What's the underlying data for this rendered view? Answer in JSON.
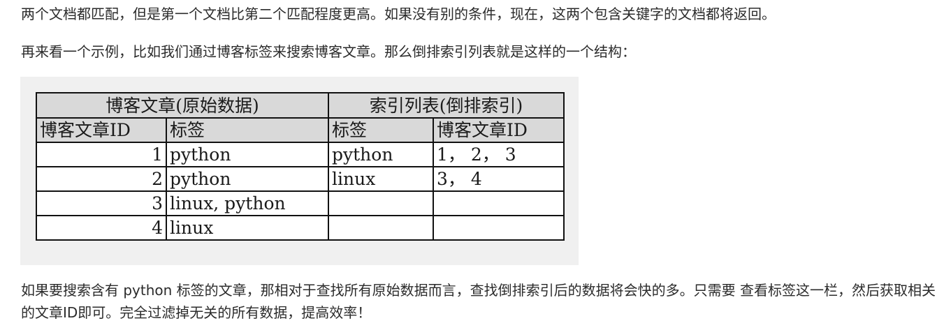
{
  "paragraphs": {
    "p1": "两个文档都匹配，但是第一个文档比第二个匹配程度更高。如果没有别的条件，现在，这两个包含关键字的文档都将返回。",
    "p2": "再来看一个示例，比如我们通过博客标签来搜索博客文章。那么倒排索引列表就是这样的一个结构：",
    "p3": "如果要搜索含有 python 标签的文章，那相对于查找所有原始数据而言，查找倒排索引后的数据将会快的多。只需要 查看标签这一栏，然后获取相关的文章ID即可。完全过滤掉无关的所有数据，提高效率！"
  },
  "table": {
    "group_headers": [
      "博客文章(原始数据)",
      "索引列表(倒排索引)"
    ],
    "column_headers": [
      "博客文章ID",
      "标签",
      "标签",
      "博客文章ID"
    ],
    "rows": [
      [
        "1",
        "python",
        "python",
        "1， 2， 3"
      ],
      [
        "2",
        "python",
        "linux",
        "3， 4"
      ],
      [
        "3",
        "linux, python",
        "",
        ""
      ],
      [
        "4",
        "linux",
        "",
        ""
      ]
    ]
  }
}
